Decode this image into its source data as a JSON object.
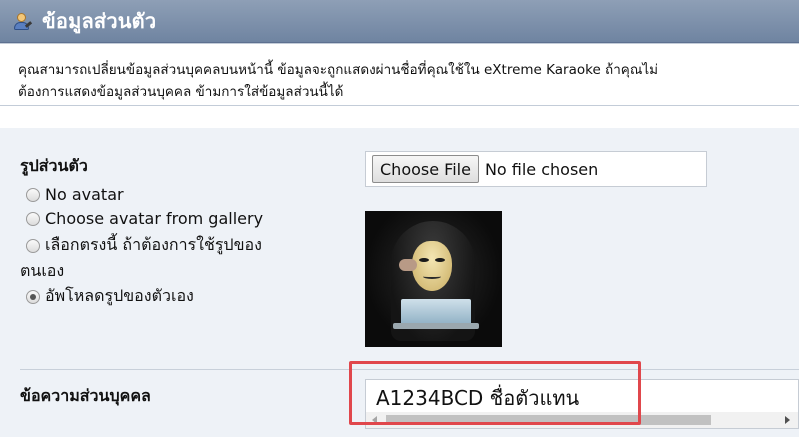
{
  "header": {
    "title": "ข้อมูลส่วนตัว",
    "icon": "user-edit-icon"
  },
  "description": {
    "line1": "คุณสามารถเปลี่ยนข้อมูลส่วนบุคคลบนหน้านี้ ข้อมูลจะถูกแสดงผ่านชื่อที่คุณใช้ใน eXtreme Karaoke ถ้าคุณไม่",
    "line2": "ต้องการแสดงข้อมูลส่วนบุคคล ข้ามการใส่ข้อมูลส่วนนี้ได้"
  },
  "avatar": {
    "label": "รูปส่วนตัว",
    "options": [
      {
        "label": "No avatar",
        "checked": false
      },
      {
        "label": "Choose avatar from gallery",
        "checked": false
      },
      {
        "label": "เลือกตรงนี้ ถ้าต้องการใช้รูปของ",
        "checked": false
      },
      {
        "label": "อัพโหลดรูปของตัวเอง",
        "checked": true
      }
    ],
    "option3_wrap": "ตนเอง",
    "file_button": "Choose File",
    "file_status": "No file chosen"
  },
  "signature": {
    "label": "ข้อความส่วนบุคคล",
    "value": "A1234BCD ชื่อตัวแทน"
  },
  "colors": {
    "header_bg": "#7a8da8",
    "panel_bg": "#eef2f7",
    "highlight": "#e0474c"
  }
}
